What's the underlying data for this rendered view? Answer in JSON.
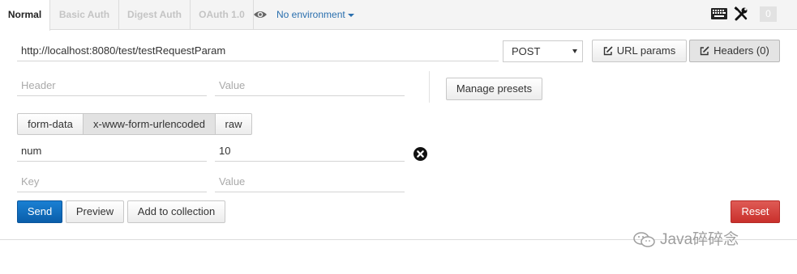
{
  "auth_tabs": [
    {
      "label": "Normal",
      "active": true
    },
    {
      "label": "Basic Auth",
      "active": false
    },
    {
      "label": "Digest Auth",
      "active": false
    },
    {
      "label": "OAuth 1.0",
      "active": false
    }
  ],
  "environment": {
    "label": "No environment",
    "icon": "eye-icon"
  },
  "top_icons": [
    "keyboard-icon",
    "wrench-screwdriver-icon"
  ],
  "badge_count": "0",
  "request": {
    "url": "http://localhost:8080/test/testRequestParam",
    "method": "POST",
    "url_params_label": "URL params",
    "headers_label": "Headers (0)"
  },
  "header_row": {
    "key_placeholder": "Header",
    "value_placeholder": "Value"
  },
  "manage_presets_label": "Manage presets",
  "body_tabs": [
    {
      "label": "form-data",
      "active": false
    },
    {
      "label": "x-www-form-urlencoded",
      "active": true
    },
    {
      "label": "raw",
      "active": false
    }
  ],
  "form_rows": [
    {
      "key": "num",
      "value": "10"
    }
  ],
  "new_row": {
    "key_placeholder": "Key",
    "value_placeholder": "Value"
  },
  "actions": {
    "send": "Send",
    "preview": "Preview",
    "add_to_collection": "Add to collection",
    "reset": "Reset"
  },
  "watermark_text": "Java碎碎念",
  "colors": {
    "primary": "#0a6bc4",
    "danger": "#d9534f",
    "link": "#2a6fae"
  }
}
